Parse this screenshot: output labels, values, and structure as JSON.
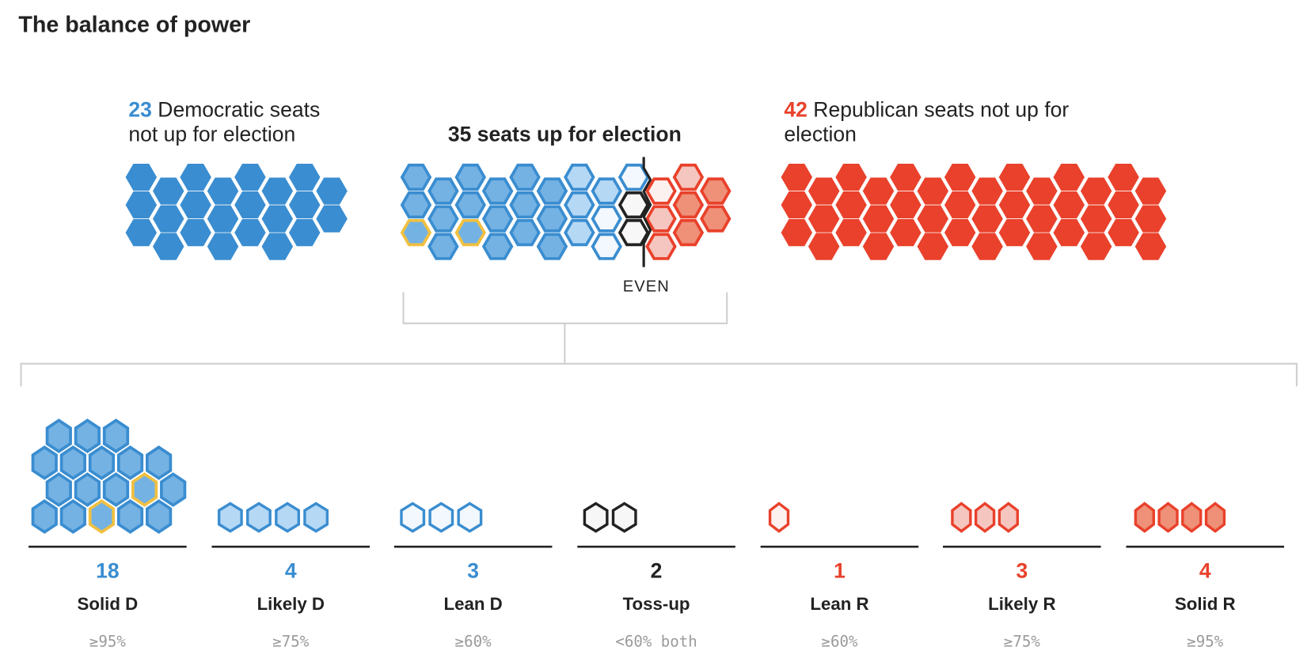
{
  "title": "The balance of power",
  "colors": {
    "dem": "#3a8dd0",
    "rep": "#e9412b",
    "tossup": "#222222",
    "highlight": "#f0c040",
    "bracket": "#cfcfcf",
    "threshold_text": "#9a9a9a",
    "fills": {
      "solid_d": "#74b2e4",
      "likely_d": "#b5d8f5",
      "lean_d": "#f2f8fd",
      "tossup": "#f7f7f7",
      "lean_r": "#fdf1ef",
      "likely_r": "#f5c6c0",
      "solid_r": "#ef9078"
    }
  },
  "headers": {
    "dem_count": "23",
    "dem_text_line1": " Democratic seats",
    "dem_text_line2": "not up for election",
    "up_title": "35 seats up for election",
    "rep_count": "42",
    "rep_text_line1": " Republican seats not up for",
    "rep_text_line2": "election",
    "even_label": "EVEN"
  },
  "chart_data": {
    "type": "hex-seat-chart",
    "title": "The balance of power",
    "not_up": [
      {
        "party": "Democratic",
        "seats": 23,
        "label": "Democratic seats not up for election"
      },
      {
        "party": "Republican",
        "seats": 42,
        "label": "Republican seats not up for election"
      }
    ],
    "up_for_election_total": 35,
    "majority_marker": "EVEN",
    "categories": [
      {
        "key": "solid_d",
        "name": "Solid D",
        "count": 18,
        "threshold": "≥95%",
        "party": "dem",
        "highlighted": 2
      },
      {
        "key": "likely_d",
        "name": "Likely D",
        "count": 4,
        "threshold": "≥75%",
        "party": "dem",
        "highlighted": 0
      },
      {
        "key": "lean_d",
        "name": "Lean D",
        "count": 3,
        "threshold": "≥60%",
        "party": "dem",
        "highlighted": 0
      },
      {
        "key": "tossup",
        "name": "Toss-up",
        "count": 2,
        "threshold": "<60% both",
        "party": "tossup",
        "highlighted": 0
      },
      {
        "key": "lean_r",
        "name": "Lean R",
        "count": 1,
        "threshold": "≥60%",
        "party": "rep",
        "highlighted": 0
      },
      {
        "key": "likely_r",
        "name": "Likely R",
        "count": 3,
        "threshold": "≥75%",
        "party": "rep",
        "highlighted": 0
      },
      {
        "key": "solid_r",
        "name": "Solid R",
        "count": 4,
        "threshold": "≥95%",
        "party": "rep",
        "highlighted": 0
      }
    ],
    "up_for_election_columns": [
      [
        "solid_d",
        "solid_d",
        "solid_d*"
      ],
      [
        "solid_d",
        "solid_d",
        "solid_d"
      ],
      [
        "solid_d",
        "solid_d",
        "solid_d*"
      ],
      [
        "solid_d",
        "solid_d",
        "solid_d"
      ],
      [
        "solid_d",
        "solid_d",
        "solid_d"
      ],
      [
        "solid_d",
        "solid_d",
        "solid_d"
      ],
      [
        "likely_d",
        "likely_d",
        "likely_d"
      ],
      [
        "likely_d",
        "lean_d",
        "lean_d"
      ],
      [
        "lean_d",
        "tossup",
        "tossup"
      ],
      [
        "lean_r",
        "likely_r",
        "likely_r"
      ],
      [
        "likely_r",
        "solid_r",
        "solid_r"
      ],
      [
        "solid_r",
        "solid_r"
      ]
    ]
  }
}
